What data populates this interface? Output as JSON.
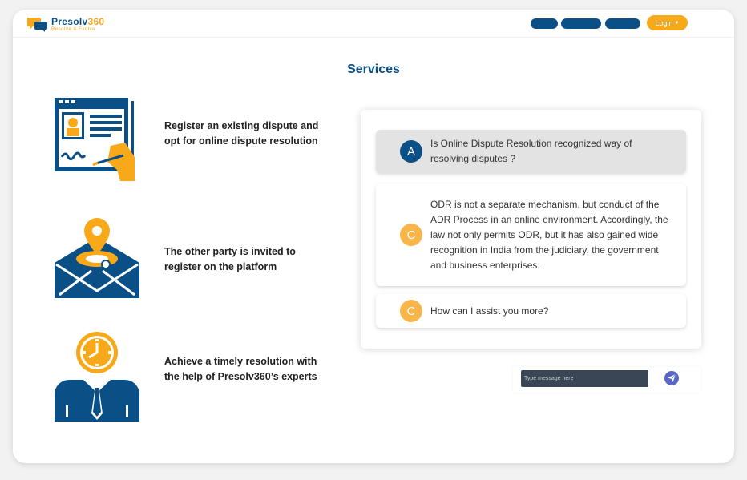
{
  "header": {
    "brand": "Presolv360",
    "brand_main": "Presolv",
    "brand_num": "360",
    "tagline": "Resolve & Evolve",
    "login_label": "Login"
  },
  "page_title": "Services",
  "services": [
    {
      "text": "Register an existing dispute and opt for online dispute resolution",
      "icon": "register-document-icon"
    },
    {
      "text": "The other party is invited to register on the platform",
      "icon": "envelope-location-icon"
    },
    {
      "text": "Achieve a timely resolution with the help of Presolv360’s experts",
      "icon": "person-clock-icon"
    }
  ],
  "chat": {
    "messages": [
      {
        "avatar": "A",
        "text": "Is Online Dispute Resolution recognized way of resolving disputes ?"
      },
      {
        "avatar": "C",
        "text": "ODR is not a separate mechanism, but conduct of the ADR Process in an online environment. Accordingly, the law not only permits ODR, but it has also gained wide recognition in India from the judiciary, the government and business enterprises."
      },
      {
        "avatar": "C",
        "text": "How can I assist you more?"
      }
    ],
    "input_placeholder": "Type message here",
    "send_icon": "send-icon"
  },
  "colors": {
    "brand_blue": "#0b4f87",
    "accent_orange": "#f8a91a",
    "send_purple": "#5866c6"
  }
}
